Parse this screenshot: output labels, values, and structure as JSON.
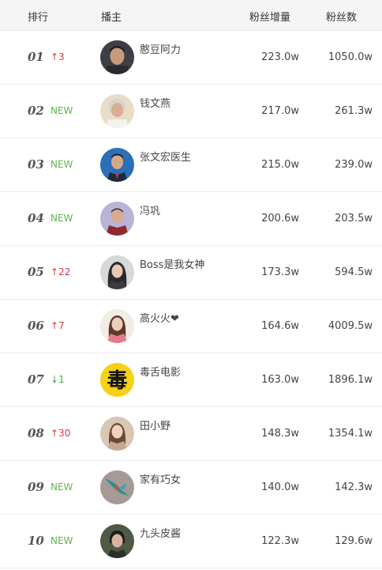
{
  "header": {
    "rank": "排行",
    "anchor": "播主",
    "growth": "粉丝增量",
    "fans": "粉丝数"
  },
  "rows": [
    {
      "rank": "01",
      "change": "↑3",
      "change_type": "up",
      "name": "憨豆阿力",
      "growth": "223.0w",
      "fans": "1050.0w"
    },
    {
      "rank": "02",
      "change": "NEW",
      "change_type": "new",
      "name": "钱文燕",
      "growth": "217.0w",
      "fans": "261.3w"
    },
    {
      "rank": "03",
      "change": "NEW",
      "change_type": "new",
      "name": "张文宏医生",
      "growth": "215.0w",
      "fans": "239.0w"
    },
    {
      "rank": "04",
      "change": "NEW",
      "change_type": "new",
      "name": "冯巩",
      "growth": "200.6w",
      "fans": "203.5w"
    },
    {
      "rank": "05",
      "change": "↑22",
      "change_type": "up",
      "name": "Boss是我女神",
      "growth": "173.3w",
      "fans": "594.5w"
    },
    {
      "rank": "06",
      "change": "↑7",
      "change_type": "up",
      "name": "高火火❤",
      "growth": "164.6w",
      "fans": "4009.5w"
    },
    {
      "rank": "07",
      "change": "↓1",
      "change_type": "down",
      "name": "毒舌电影",
      "growth": "163.0w",
      "fans": "1896.1w"
    },
    {
      "rank": "08",
      "change": "↑30",
      "change_type": "up",
      "name": "田小野",
      "growth": "148.3w",
      "fans": "1354.1w"
    },
    {
      "rank": "09",
      "change": "NEW",
      "change_type": "new",
      "name": "家有巧女",
      "growth": "140.0w",
      "fans": "142.3w"
    },
    {
      "rank": "10",
      "change": "NEW",
      "change_type": "new",
      "name": "九头皮酱",
      "growth": "122.3w",
      "fans": "129.6w"
    }
  ],
  "avatar_logo_text": "毒"
}
